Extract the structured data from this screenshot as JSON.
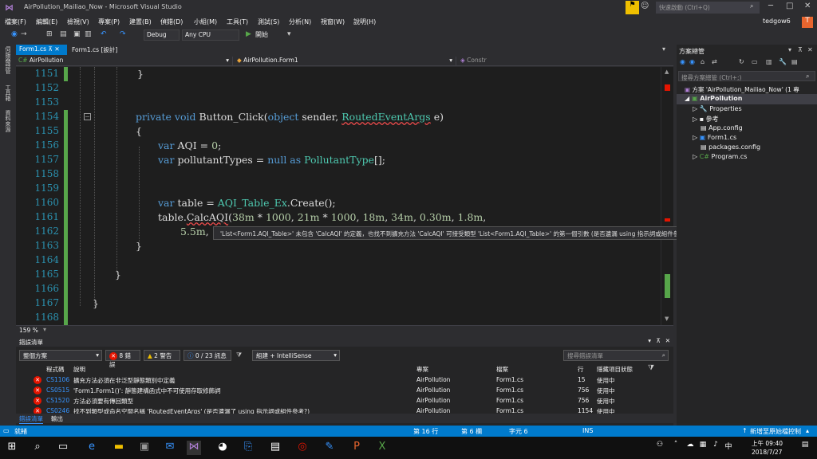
{
  "titlebar": {
    "title": "AirPollution_Mailiao_Now - Microsoft Visual Studio",
    "quick_launch": "快速啟動 (Ctrl+Q)"
  },
  "menu": [
    "檔案(F)",
    "編輯(E)",
    "檢視(V)",
    "專案(P)",
    "建置(B)",
    "偵錯(D)",
    "小組(M)",
    "工具(T)",
    "測試(S)",
    "分析(N)",
    "視窗(W)",
    "說明(H)"
  ],
  "user": {
    "name": "tedgow6",
    "initial": "T"
  },
  "toolbar": {
    "config": "Debug",
    "platform": "Any CPU",
    "start": "開始"
  },
  "left_strip": [
    "伺服器總管",
    "工具箱",
    "資料來源"
  ],
  "doc_tabs": [
    {
      "label": "Form1.cs",
      "active": true
    },
    {
      "label": "Form1.cs [設計]",
      "active": false
    }
  ],
  "nav": {
    "project": "AirPollution",
    "class": "AirPollution.Form1",
    "member": "Constr"
  },
  "editor": {
    "line_numbers": [
      "1151",
      "1152",
      "1153",
      "1154",
      "1155",
      "1156",
      "1157",
      "1158",
      "1159",
      "1160",
      "1161",
      "1162",
      "1163",
      "1164",
      "1165",
      "1166",
      "1167",
      "1168"
    ],
    "zoom": "159 %"
  },
  "tooltip": "'List<Form1.AQI_Table>' 未包含 'CalcAQI' 的定義，也找不到擴充方法 'CalcAQI' 可接受類型 'List<Form1.AQI_Table>' 的第一個引數 (是否遺漏 using 指示詞或組件參考?)",
  "error_list": {
    "title": "錯誤清單",
    "scope": "整個方案",
    "errors": "8 錯誤",
    "warnings": "2 警告",
    "messages": "0 / 23 訊息",
    "build": "組建 + IntelliSense",
    "search": "搜尋錯誤清單",
    "headers": {
      "code": "程式碼",
      "desc": "說明",
      "project": "專案",
      "file": "檔案",
      "line": "行",
      "state": "隱藏項目狀態"
    },
    "rows": [
      {
        "code": "CS1106",
        "desc": "擴充方法必須在非泛型靜態類別中定義",
        "project": "AirPollution",
        "file": "Form1.cs",
        "line": "15",
        "state": "使用中"
      },
      {
        "code": "CS0515",
        "desc": "'Form1.Form1()': 靜態建構函式中不可使用存取修飾詞",
        "project": "AirPollution",
        "file": "Form1.cs",
        "line": "756",
        "state": "使用中"
      },
      {
        "code": "CS1520",
        "desc": "方法必須要有傳回類型",
        "project": "AirPollution",
        "file": "Form1.cs",
        "line": "756",
        "state": "使用中"
      },
      {
        "code": "CS0246",
        "desc": "找不到類型或命名空間名稱 'RoutedEventArgs' (是否遺漏了 using 指示詞或組件參考?)",
        "project": "AirPollution",
        "file": "Form1.cs",
        "line": "1154",
        "state": "使用中"
      }
    ],
    "bottom_tabs": [
      "錯誤清單",
      "輸出"
    ]
  },
  "solution_explorer": {
    "title": "方案總管",
    "search": "搜尋方案總管 (Ctrl+;)",
    "solution": "方案 'AirPollution_Mailiao_Now' (1 專",
    "project": "AirPollution",
    "items": [
      "Properties",
      "參考",
      "App.config",
      "Form1.cs",
      "packages.config",
      "Program.cs"
    ]
  },
  "status": {
    "ready": "就緒",
    "row": "第 16 行",
    "col": "第 6 欄",
    "ch": "字元 6",
    "ins": "INS",
    "add_src": "新增至原始檔控制"
  },
  "taskbar": {
    "time": "上午 09:40",
    "date": "2018/7/27"
  }
}
